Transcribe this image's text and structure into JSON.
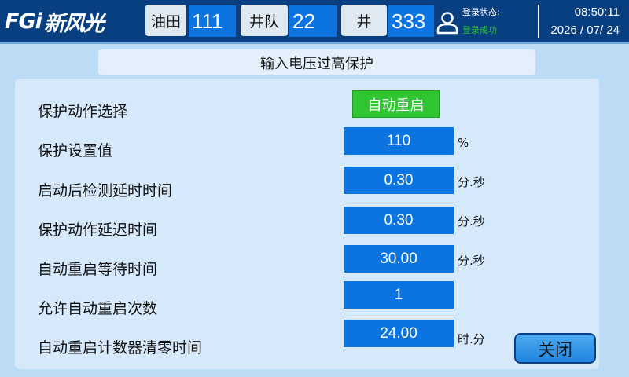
{
  "header": {
    "logo_latin": "FGi",
    "logo_cn": "新风光",
    "oilfield_label": "油田",
    "oilfield_value": "111",
    "team_label": "井队",
    "team_value": "22",
    "well_label": "井",
    "well_value": "333",
    "login_label": "登录状态:",
    "login_status": "登录成功",
    "time": "08:50:11",
    "date": "2026 / 07/ 24",
    "colors": {
      "bar": "#083f80",
      "value_box": "#0b74e0",
      "login_ok": "#2bbc34"
    }
  },
  "page_title": "输入电压过高保护",
  "settings": {
    "action": {
      "label": "保护动作选择",
      "value": "自动重启"
    },
    "set_value": {
      "label": "保护设置值",
      "value": "110",
      "unit": "%"
    },
    "startup_delay": {
      "label": "启动后检测延时时间",
      "value": "0.30",
      "unit": "分.秒"
    },
    "action_delay": {
      "label": "保护动作延迟时间",
      "value": "0.30",
      "unit": "分.秒"
    },
    "restart_wait": {
      "label": "自动重启等待时间",
      "value": "30.00",
      "unit": "分.秒"
    },
    "restart_count": {
      "label": "允许自动重启次数",
      "value": "1",
      "unit": ""
    },
    "counter_reset": {
      "label": "自动重启计数器清零时间",
      "value": "24.00",
      "unit": "时.分"
    }
  },
  "close_label": "关闭",
  "icons": {
    "user": "user-icon"
  }
}
